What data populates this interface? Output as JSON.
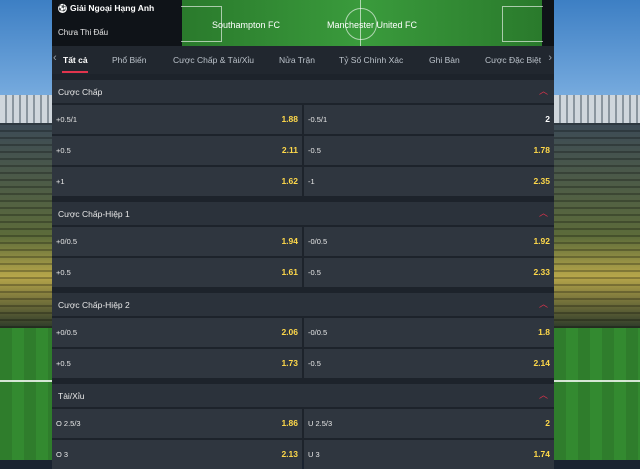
{
  "header": {
    "league": "Giải Ngoại Hạng Anh",
    "status": "Chưa Thi Đấu",
    "home_team": "Southampton FC",
    "away_team": "Manchester United FC"
  },
  "tabs": [
    {
      "label": "Tất cả"
    },
    {
      "label": "Phổ Biến"
    },
    {
      "label": "Cược Chấp & Tài/Xỉu"
    },
    {
      "label": "Nửa Trận"
    },
    {
      "label": "Tỷ Số Chính Xác"
    },
    {
      "label": "Ghi Bàn"
    },
    {
      "label": "Cược Đặc Biệt"
    }
  ],
  "sections": [
    {
      "title": "Cược Chấp",
      "rows": [
        {
          "left_label": "+0.5/1",
          "left_odd": "1.88",
          "right_label": "-0.5/1",
          "right_odd": "2"
        },
        {
          "left_label": "+0.5",
          "left_odd": "2.11",
          "right_label": "-0.5",
          "right_odd": "1.78"
        },
        {
          "left_label": "+1",
          "left_odd": "1.62",
          "right_label": "-1",
          "right_odd": "2.35"
        }
      ]
    },
    {
      "title": "Cược Chấp-Hiệp 1",
      "rows": [
        {
          "left_label": "+0/0.5",
          "left_odd": "1.94",
          "right_label": "-0/0.5",
          "right_odd": "1.92"
        },
        {
          "left_label": "+0.5",
          "left_odd": "1.61",
          "right_label": "-0.5",
          "right_odd": "2.33"
        }
      ]
    },
    {
      "title": "Cược Chấp-Hiệp 2",
      "rows": [
        {
          "left_label": "+0/0.5",
          "left_odd": "2.06",
          "right_label": "-0/0.5",
          "right_odd": "1.8"
        },
        {
          "left_label": "+0.5",
          "left_odd": "1.73",
          "right_label": "-0.5",
          "right_odd": "2.14"
        }
      ]
    },
    {
      "title": "Tài/Xỉu",
      "rows": [
        {
          "left_label": "O 2.5/3",
          "left_odd": "1.86",
          "right_label": "U 2.5/3",
          "right_odd": "2"
        },
        {
          "left_label": "O 3",
          "left_odd": "2.13",
          "right_label": "U 3",
          "right_odd": "1.74"
        }
      ]
    }
  ],
  "colors": {
    "accent": "#e0344d",
    "odd_highlight": "#ffd94a",
    "panel": "#2f363f"
  }
}
